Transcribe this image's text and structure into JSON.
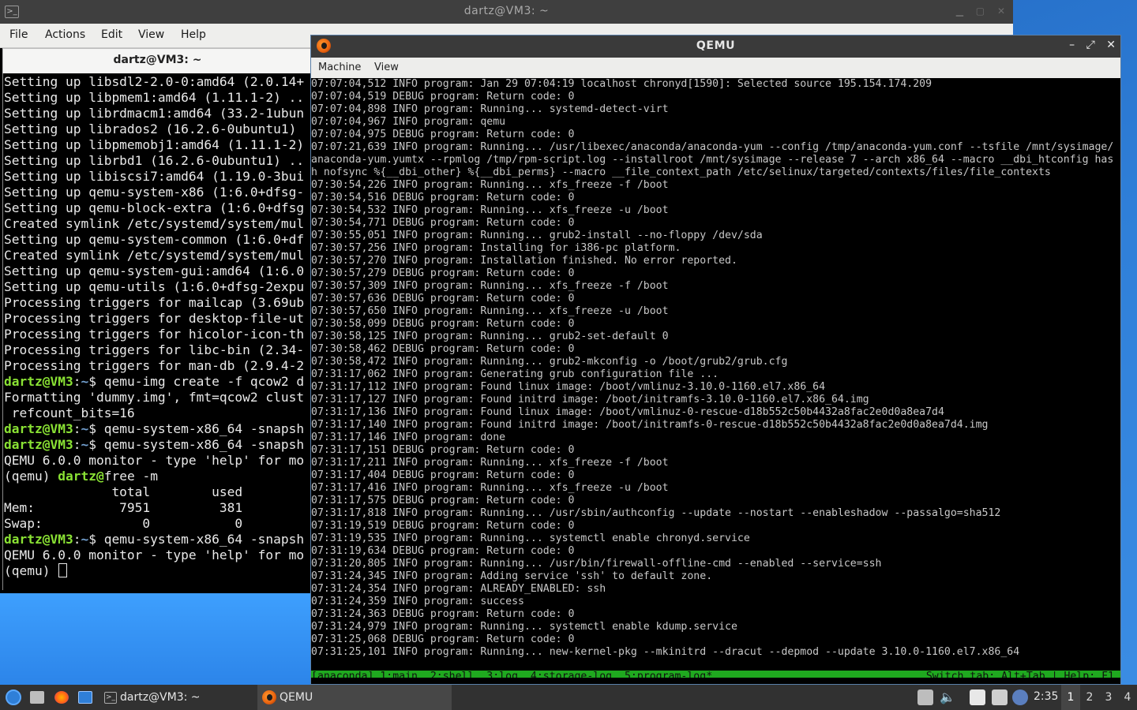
{
  "terminal": {
    "title": "dartz@VM3: ~",
    "icon": "terminal-icon",
    "menu": [
      "File",
      "Actions",
      "Edit",
      "View",
      "Help"
    ],
    "tab_label": "dartz@VM3: ~",
    "lines": [
      {
        "text": "Setting up libsdl2-2.0-0:amd64 (2.0.14+"
      },
      {
        "text": "Setting up libpmem1:amd64 (1.11.1-2) .."
      },
      {
        "text": "Setting up librdmacm1:amd64 (33.2-1ubun"
      },
      {
        "text": "Setting up librados2 (16.2.6-0ubuntu1) "
      },
      {
        "text": "Setting up libpmemobj1:amd64 (1.11.1-2)"
      },
      {
        "text": "Setting up librbd1 (16.2.6-0ubuntu1) .."
      },
      {
        "text": "Setting up libiscsi7:amd64 (1.19.0-3bui"
      },
      {
        "text": "Setting up qemu-system-x86 (1:6.0+dfsg-"
      },
      {
        "text": "Setting up qemu-block-extra (1:6.0+dfsg"
      },
      {
        "text": "Created symlink /etc/systemd/system/mul"
      },
      {
        "text": "Setting up qemu-system-common (1:6.0+df"
      },
      {
        "text": "Created symlink /etc/systemd/system/mul"
      },
      {
        "text": "Setting up qemu-system-gui:amd64 (1:6.0"
      },
      {
        "text": "Setting up qemu-utils (1:6.0+dfsg-2expu"
      },
      {
        "text": "Processing triggers for mailcap (3.69ub"
      },
      {
        "text": "Processing triggers for desktop-file-ut"
      },
      {
        "text": "Processing triggers for hicolor-icon-th"
      },
      {
        "text": "Processing triggers for libc-bin (2.34-"
      },
      {
        "text": "Processing triggers for man-db (2.9.4-2"
      },
      {
        "user": "dartz@VM3",
        "sep": ":",
        "path": "~",
        "cmd": "$ qemu-img create -f qcow2 d"
      },
      {
        "text": "Formatting 'dummy.img', fmt=qcow2 clust"
      },
      {
        "text": " refcount_bits=16"
      },
      {
        "user": "dartz@VM3",
        "sep": ":",
        "path": "~",
        "cmd": "$ qemu-system-x86_64 -snapsh"
      },
      {
        "user": "dartz@VM3",
        "sep": ":",
        "path": "~",
        "cmd": "$ qemu-system-x86_64 -snapsh"
      },
      {
        "text": "QEMU 6.0.0 monitor - type 'help' for mo"
      },
      {
        "pre": "(qemu) ",
        "user": "dartz@",
        "cmd": "free -m"
      },
      {
        "text": "              total        used"
      },
      {
        "text": "Mem:           7951         381"
      },
      {
        "text": "Swap:             0           0"
      },
      {
        "user": "dartz@VM3",
        "sep": ":",
        "path": "~",
        "cmd": "$ qemu-system-x86_64 -snapsh"
      },
      {
        "text": "QEMU 6.0.0 monitor - type 'help' for mo"
      },
      {
        "text": "(qemu) ",
        "cursor": true
      }
    ]
  },
  "qemu": {
    "title": "QEMU",
    "icon": "qemu-logo-icon",
    "menu": [
      "Machine",
      "View"
    ],
    "log": [
      "07:07:04,512 INFO program: Jan 29 07:04:19 localhost chronyd[1590]: Selected source 195.154.174.209",
      "07:07:04,519 DEBUG program: Return code: 0",
      "07:07:04,898 INFO program: Running... systemd-detect-virt",
      "07:07:04,967 INFO program: qemu",
      "07:07:04,975 DEBUG program: Return code: 0",
      "07:07:21,639 INFO program: Running... /usr/libexec/anaconda/anaconda-yum --config /tmp/anaconda-yum.conf --tsfile /mnt/sysimage/",
      "anaconda-yum.yumtx --rpmlog /tmp/rpm-script.log --installroot /mnt/sysimage --release 7 --arch x86_64 --macro __dbi_htconfig has",
      "h nofsync %{__dbi_other} %{__dbi_perms} --macro __file_context_path /etc/selinux/targeted/contexts/files/file_contexts",
      "07:30:54,226 INFO program: Running... xfs_freeze -f /boot",
      "07:30:54,516 DEBUG program: Return code: 0",
      "07:30:54,532 INFO program: Running... xfs_freeze -u /boot",
      "07:30:54,771 DEBUG program: Return code: 0",
      "07:30:55,051 INFO program: Running... grub2-install --no-floppy /dev/sda",
      "07:30:57,256 INFO program: Installing for i386-pc platform.",
      "07:30:57,270 INFO program: Installation finished. No error reported.",
      "07:30:57,279 DEBUG program: Return code: 0",
      "07:30:57,309 INFO program: Running... xfs_freeze -f /boot",
      "07:30:57,636 DEBUG program: Return code: 0",
      "07:30:57,650 INFO program: Running... xfs_freeze -u /boot",
      "07:30:58,099 DEBUG program: Return code: 0",
      "07:30:58,125 INFO program: Running... grub2-set-default 0",
      "07:30:58,462 DEBUG program: Return code: 0",
      "07:30:58,472 INFO program: Running... grub2-mkconfig -o /boot/grub2/grub.cfg",
      "07:31:17,062 INFO program: Generating grub configuration file ...",
      "07:31:17,112 INFO program: Found linux image: /boot/vmlinuz-3.10.0-1160.el7.x86_64",
      "07:31:17,127 INFO program: Found initrd image: /boot/initramfs-3.10.0-1160.el7.x86_64.img",
      "07:31:17,136 INFO program: Found linux image: /boot/vmlinuz-0-rescue-d18b552c50b4432a8fac2e0d0a8ea7d4",
      "07:31:17,140 INFO program: Found initrd image: /boot/initramfs-0-rescue-d18b552c50b4432a8fac2e0d0a8ea7d4.img",
      "07:31:17,146 INFO program: done",
      "07:31:17,151 DEBUG program: Return code: 0",
      "07:31:17,211 INFO program: Running... xfs_freeze -f /boot",
      "07:31:17,404 DEBUG program: Return code: 0",
      "07:31:17,416 INFO program: Running... xfs_freeze -u /boot",
      "07:31:17,575 DEBUG program: Return code: 0",
      "07:31:17,818 INFO program: Running... /usr/sbin/authconfig --update --nostart --enableshadow --passalgo=sha512",
      "07:31:19,519 DEBUG program: Return code: 0",
      "07:31:19,535 INFO program: Running... systemctl enable chronyd.service",
      "07:31:19,634 DEBUG program: Return code: 0",
      "07:31:20,805 INFO program: Running... /usr/bin/firewall-offline-cmd --enabled --service=ssh",
      "07:31:24,345 INFO program: Adding service 'ssh' to default zone.",
      "07:31:24,354 INFO program: ALREADY_ENABLED: ssh",
      "07:31:24,359 INFO program: success",
      "07:31:24,363 DEBUG program: Return code: 0",
      "07:31:24,979 INFO program: Running... systemctl enable kdump.service",
      "07:31:25,068 DEBUG program: Return code: 0",
      "07:31:25,101 INFO program: Running... new-kernel-pkg --mkinitrd --dracut --depmod --update 3.10.0-1160.el7.x86_64"
    ],
    "status_left": "[anaconda] 1:main  2:shell  3:log  4:storage-log  5:program-log*",
    "status_right": "Switch tab: Alt+Tab | Help: F1",
    "status_color": "#1fa91f"
  },
  "taskbar": {
    "tasks": [
      {
        "label": "dartz@VM3: ~",
        "icon": "terminal-icon"
      },
      {
        "label": "QEMU",
        "icon": "qemu-logo-icon"
      }
    ],
    "clock": "2:35",
    "workspaces": [
      "1",
      "2",
      "3",
      "4"
    ],
    "active_workspace": "1"
  },
  "colors": {
    "prompt_user": "#8ae234",
    "prompt_path": "#729fcf",
    "desktop": "#2f7fd8"
  }
}
